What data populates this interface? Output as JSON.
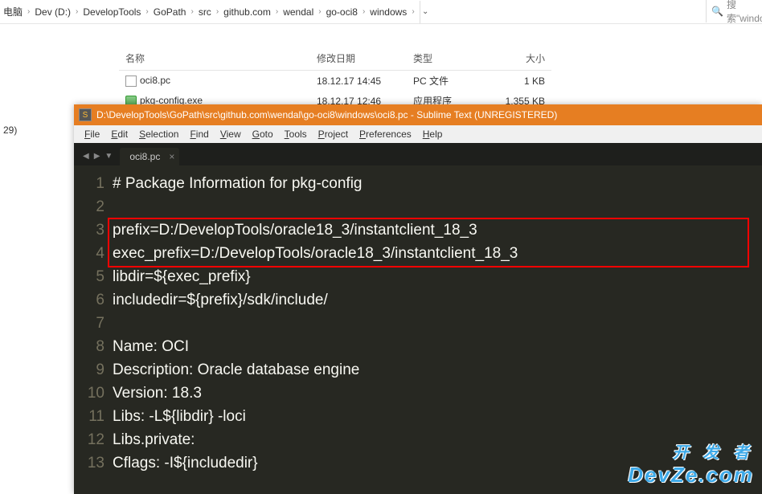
{
  "explorer": {
    "breadcrumbs": [
      "电脑",
      "Dev (D:)",
      "DevelopTools",
      "GoPath",
      "src",
      "github.com",
      "wendal",
      "go-oci8",
      "windows"
    ],
    "search_placeholder": "搜索\"window",
    "sidebar_item": "29)",
    "columns": {
      "name": "名称",
      "date": "修改日期",
      "type": "类型",
      "size": "大小"
    },
    "files": [
      {
        "name": "oci8.pc",
        "date": "18.12.17 14:45",
        "type": "PC 文件",
        "size": "1 KB",
        "icon": "file"
      },
      {
        "name": "pkg-config.exe",
        "date": "18.12.17 12:46",
        "type": "应用程序",
        "size": "1,355 KB",
        "icon": "exe"
      }
    ]
  },
  "sublime": {
    "title": "D:\\DevelopTools\\GoPath\\src\\github.com\\wendal\\go-oci8\\windows\\oci8.pc - Sublime Text (UNREGISTERED)",
    "menu": [
      "File",
      "Edit",
      "Selection",
      "Find",
      "View",
      "Goto",
      "Tools",
      "Project",
      "Preferences",
      "Help"
    ],
    "tab": "oci8.pc",
    "lines": [
      "# Package Information for pkg-config",
      "",
      "prefix=D:/DevelopTools/oracle18_3/instantclient_18_3",
      "exec_prefix=D:/DevelopTools/oracle18_3/instantclient_18_3",
      "libdir=${exec_prefix}",
      "includedir=${prefix}/sdk/include/",
      "",
      "Name: OCI",
      "Description: Oracle database engine",
      "Version: 18.3",
      "Libs: -L${libdir} -loci",
      "Libs.private:",
      "Cflags: -I${includedir}"
    ]
  },
  "watermark": {
    "cn": "开 发 者",
    "en": "DevZe.com"
  }
}
